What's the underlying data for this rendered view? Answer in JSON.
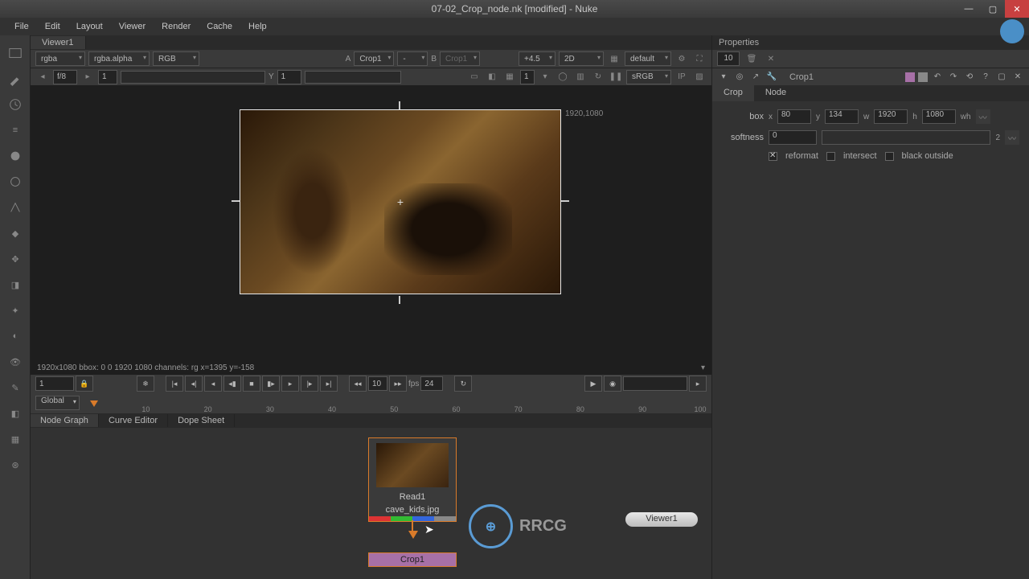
{
  "title": "07-02_Crop_node.nk [modified] - Nuke",
  "menu": [
    "File",
    "Edit",
    "Layout",
    "Viewer",
    "Render",
    "Cache",
    "Help"
  ],
  "viewer": {
    "tab": "Viewer1",
    "channel": "rgba",
    "alpha": "rgba.alpha",
    "rgb": "RGB",
    "a_label": "A",
    "a_val": "Crop1",
    "dash": "-",
    "b_label": "B",
    "b_val": "Crop1",
    "gain": "+4.5",
    "mode": "2D",
    "proxy": "default",
    "fstop": "f/8",
    "frame": "1",
    "y_label": "Y",
    "y_val": "1",
    "colorspace": "sRGB",
    "bbox_label": "1920,1080",
    "info": "1920x1080 bbox: 0 0 1920 1080 channels: rg  x=1395 y=-158",
    "play_frame": "10",
    "fps_label": "fps",
    "fps": "24",
    "global": "Global",
    "cur_frame": "1",
    "ticks": [
      "10",
      "20",
      "30",
      "40",
      "50",
      "60",
      "70",
      "80",
      "90",
      "100"
    ]
  },
  "nodegraph": {
    "tabs": [
      "Node Graph",
      "Curve Editor",
      "Dope Sheet"
    ],
    "read_name": "Read1",
    "read_file": "cave_kids.jpg",
    "crop_name": "Crop1",
    "viewer_name": "Viewer1",
    "logo": "RRCG"
  },
  "props": {
    "title": "Properties",
    "count": "10",
    "node": "Crop1",
    "tabs": [
      "Crop",
      "Node"
    ],
    "box_label": "box",
    "x": "80",
    "y": "134",
    "w": "1920",
    "h": "1080",
    "xl": "x",
    "yl": "y",
    "wl": "w",
    "hl": "h",
    "whl": "wh",
    "soft_label": "softness",
    "soft": "0",
    "two": "2",
    "reformat": "reformat",
    "intersect": "intersect",
    "black": "black outside"
  }
}
